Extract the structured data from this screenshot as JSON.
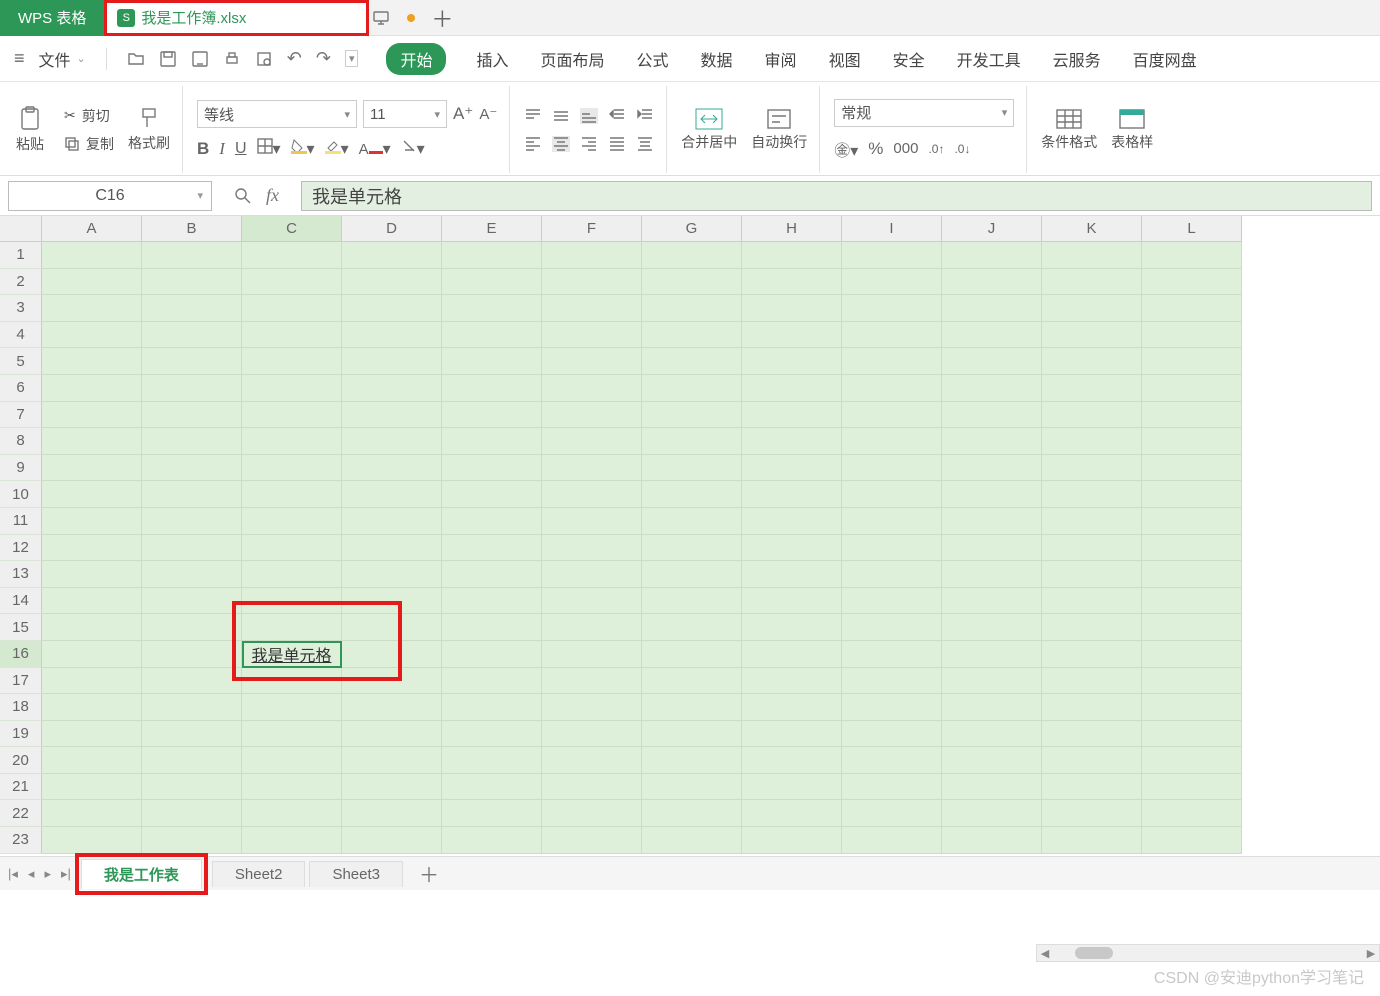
{
  "app": {
    "brand": "WPS 表格"
  },
  "doc_tab": {
    "label": "我是工作簿.xlsx",
    "icon_letter": "S"
  },
  "file_menu": "文件",
  "ribbon_tabs": [
    "开始",
    "插入",
    "页面布局",
    "公式",
    "数据",
    "审阅",
    "视图",
    "安全",
    "开发工具",
    "云服务",
    "百度网盘"
  ],
  "clipboard": {
    "paste": "粘贴",
    "cut": "剪切",
    "copy": "复制",
    "format_painter": "格式刷"
  },
  "font": {
    "name": "等线",
    "size": "11"
  },
  "merge": "合并居中",
  "wrap": "自动换行",
  "number_format": "常规",
  "cond_format": "条件格式",
  "table_style": "表格样",
  "namebox": "C16",
  "formula_value": "我是单元格",
  "columns": [
    "A",
    "B",
    "C",
    "D",
    "E",
    "F",
    "G",
    "H",
    "I",
    "J",
    "K",
    "L"
  ],
  "row_count": 23,
  "active": {
    "row": 16,
    "col": "C",
    "value": "我是单元格"
  },
  "sheets": {
    "active": "我是工作表",
    "others": [
      "Sheet2",
      "Sheet3"
    ]
  },
  "watermark": "CSDN @安迪python学习笔记"
}
